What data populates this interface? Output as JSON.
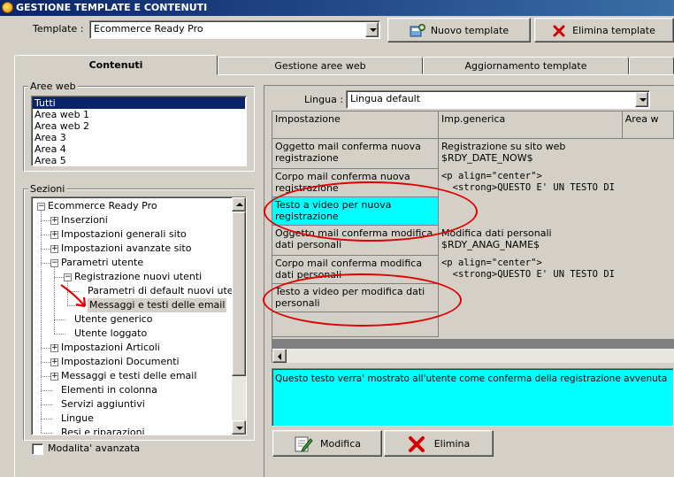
{
  "window": {
    "title": "GESTIONE TEMPLATE E CONTENUTI"
  },
  "toolbar": {
    "template_label": "Template :",
    "template_value": "Ecommerce Ready Pro",
    "new_template": "Nuovo template",
    "delete_template": "Elimina template"
  },
  "tabs": [
    {
      "label": "Contenuti",
      "active": true
    },
    {
      "label": "Gestione aree web",
      "active": false
    },
    {
      "label": "Aggiornamento template",
      "active": false
    }
  ],
  "aree_web": {
    "title": "Aree web",
    "items": [
      "Tutti",
      "Area web 1",
      "Area web 2",
      "Area 3",
      "Area 4",
      "Area 5"
    ],
    "selected": "Tutti"
  },
  "sezioni": {
    "title": "Sezioni",
    "items": [
      {
        "label": "Ecommerce Ready Pro",
        "level": 0,
        "expander": "-"
      },
      {
        "label": "Inserzioni",
        "level": 1,
        "expander": "+"
      },
      {
        "label": "Impostazioni generali sito",
        "level": 1,
        "expander": "+"
      },
      {
        "label": "Impostazioni avanzate sito",
        "level": 1,
        "expander": "+"
      },
      {
        "label": "Parametri utente",
        "level": 1,
        "expander": "-"
      },
      {
        "label": "Registrazione nuovi utenti",
        "level": 2,
        "expander": "-"
      },
      {
        "label": "Parametri di default nuovi utenti",
        "level": 3,
        "expander": ""
      },
      {
        "label": "Messaggi e testi delle email",
        "level": 3,
        "expander": "",
        "selected": true
      },
      {
        "label": "Utente generico",
        "level": 2,
        "expander": ""
      },
      {
        "label": "Utente loggato",
        "level": 2,
        "expander": ""
      },
      {
        "label": "Impostazioni Articoli",
        "level": 1,
        "expander": "+"
      },
      {
        "label": "Impostazioni Documenti",
        "level": 1,
        "expander": "+"
      },
      {
        "label": "Messaggi e testi delle email",
        "level": 1,
        "expander": "+"
      },
      {
        "label": "Elementi in colonna",
        "level": 1,
        "expander": ""
      },
      {
        "label": "Servizi aggiuntivi",
        "level": 1,
        "expander": ""
      },
      {
        "label": "Lingue",
        "level": 1,
        "expander": ""
      },
      {
        "label": "Resi e riparazioni",
        "level": 1,
        "expander": ""
      }
    ]
  },
  "advanced": {
    "label": "Modalita' avanzata",
    "checked": false
  },
  "lingua": {
    "label": "Lingua :",
    "value": "Lingua default"
  },
  "grid": {
    "columns": [
      "Impostazione",
      "Imp.generica",
      "Area w"
    ],
    "rows": [
      {
        "setting": "Oggetto mail conferma nuova registrazione",
        "value": "Registrazione su sito web\n$RDY_DATE_NOW$"
      },
      {
        "setting": "Corpo mail conferma nuova registrazione",
        "value": "<p align=\"center\">\n  <strong>QUESTO E' UN TESTO DI"
      },
      {
        "setting": "Testo a video per nuova registrazione",
        "value": ""
      },
      {
        "setting": "Oggetto mail conferma modifica dati personali",
        "value": "Modifica dati personali\n$RDY_ANAG_NAME$"
      },
      {
        "setting": "Corpo mail conferma modifica dati personali",
        "value": "<p align=\"center\">\n  <strong>QUESTO E' UN TESTO DI"
      },
      {
        "setting": "Testo a video per modifica dati personali",
        "value": ""
      },
      {
        "setting": "",
        "value": ""
      }
    ]
  },
  "preview": {
    "text": "Questo testo verra' mostrato all'utente come conferma della registrazione avvenuta"
  },
  "actions": {
    "modify": "Modifica",
    "delete": "Elimina"
  },
  "colors": {
    "titlebar": "#0a246a",
    "highlight": "#00ffff",
    "annotation": "#e00000",
    "selection": "#0a246a"
  }
}
